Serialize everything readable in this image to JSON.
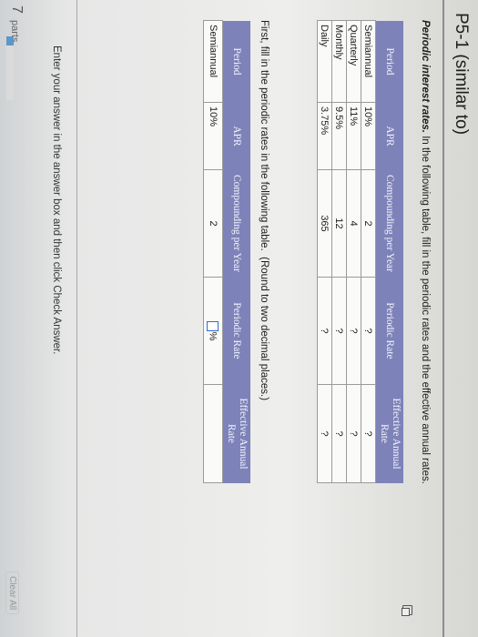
{
  "header": {
    "title": "P5-1 (similar to)"
  },
  "intro": {
    "bold": "Periodic interest rates.",
    "text": " In the following table, fill in the periodic rates and the effective annual rates."
  },
  "table1": {
    "headers": [
      "Period",
      "APR",
      "Compounding per Year",
      "Periodic Rate",
      "Effective Annual Rate"
    ],
    "rows": [
      [
        "Semiannual",
        "10%",
        "2",
        "?",
        "?"
      ],
      [
        "Quarterly",
        "11%",
        "4",
        "?",
        "?"
      ],
      [
        "Monthly",
        "9.5%",
        "12",
        "?",
        "?"
      ],
      [
        "Daily",
        "3.75%",
        "365",
        "?",
        "?"
      ]
    ]
  },
  "instruction": "First, fill in the periodic rates in the following table.",
  "round_note": "(Round to two decimal places.)",
  "table2": {
    "headers": [
      "Period",
      "APR",
      "Compounding per Year",
      "Periodic Rate",
      "Effective Annual Rate"
    ],
    "row": {
      "period": "Semiannual",
      "apr": "10%",
      "compounding": "2",
      "periodic_input": "",
      "pct": "%",
      "effective": ""
    }
  },
  "footer": {
    "enter_text": "Enter your answer in the answer box and then click Check Answer.",
    "parts_count": "7",
    "parts_label": "parts",
    "progress_fraction": 0.14,
    "progress_color": "#5b97c9",
    "clear_all": "Clear All"
  },
  "colors": {
    "header_bg": "#7d83b8",
    "input_border": "#2a6fd6"
  }
}
